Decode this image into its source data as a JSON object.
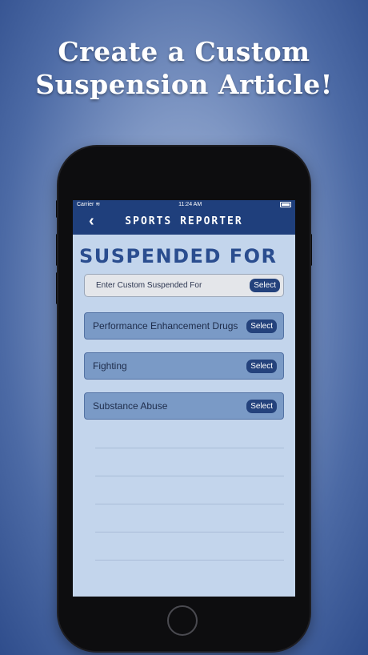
{
  "headline": {
    "line1": "Create a Custom",
    "line2": "Suspension Article!"
  },
  "status_bar": {
    "carrier": "Carrier",
    "time": "11:24 AM"
  },
  "nav": {
    "title": "SPORTS REPORTER",
    "back_icon": "chevron-left-icon"
  },
  "page": {
    "title": "SUSPENDED FOR"
  },
  "custom_input": {
    "placeholder": "Enter Custom Suspended For",
    "button_label": "Select"
  },
  "options": [
    {
      "label": "Performance Enhancement Drugs",
      "button_label": "Select"
    },
    {
      "label": "Fighting",
      "button_label": "Select"
    },
    {
      "label": "Substance Abuse",
      "button_label": "Select"
    }
  ],
  "colors": {
    "nav_bg": "#1f3f7c",
    "screen_bg": "#c3d5ec",
    "option_bg": "#7a9ac6",
    "title_color": "#2a4d8f",
    "button_bg": "#24427c"
  }
}
